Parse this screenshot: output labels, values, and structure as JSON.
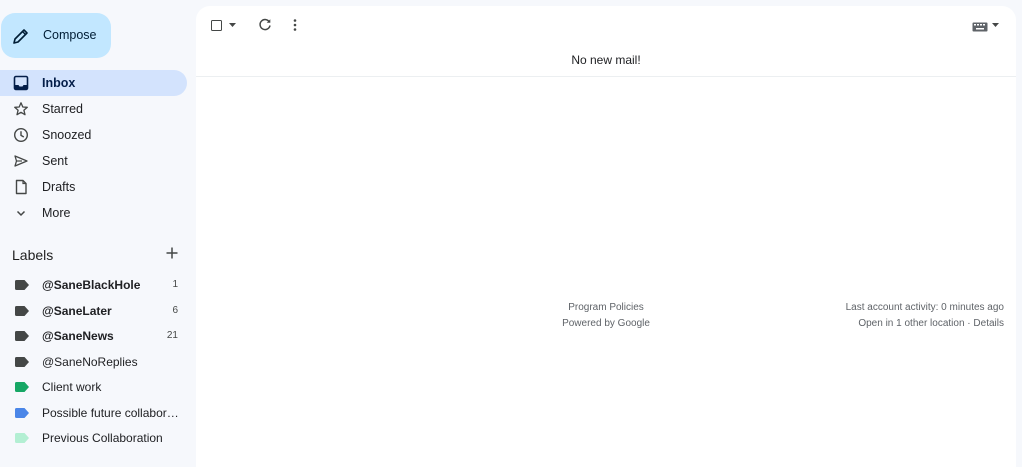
{
  "compose": {
    "label": "Compose"
  },
  "nav": [
    {
      "label": "Inbox",
      "icon": "inbox-icon",
      "active": true
    },
    {
      "label": "Starred",
      "icon": "star-icon"
    },
    {
      "label": "Snoozed",
      "icon": "clock-icon"
    },
    {
      "label": "Sent",
      "icon": "send-icon"
    },
    {
      "label": "Drafts",
      "icon": "draft-icon"
    },
    {
      "label": "More",
      "icon": "chevron-down-icon"
    }
  ],
  "labels": {
    "title": "Labels",
    "items": [
      {
        "name": "@SaneBlackHole",
        "count": "1",
        "bold": true,
        "color": "#444746"
      },
      {
        "name": "@SaneLater",
        "count": "6",
        "bold": true,
        "color": "#444746"
      },
      {
        "name": "@SaneNews",
        "count": "21",
        "bold": true,
        "color": "#444746"
      },
      {
        "name": "@SaneNoReplies",
        "count": "",
        "bold": false,
        "color": "#444746"
      },
      {
        "name": "Client work",
        "count": "",
        "bold": false,
        "color": "#16a765"
      },
      {
        "name": "Possible future collaborations",
        "count": "",
        "bold": false,
        "color": "#4a86e8"
      },
      {
        "name": "Previous Collaboration",
        "count": "",
        "bold": false,
        "color": "#b3efd3"
      }
    ]
  },
  "main": {
    "empty_message": "No new mail!",
    "footer": {
      "program_policies": "Program Policies",
      "powered_by": "Powered by Google",
      "last_activity": "Last account activity: 0 minutes ago",
      "open_in": "Open in 1 other location",
      "separator": " · ",
      "details": "Details"
    }
  }
}
